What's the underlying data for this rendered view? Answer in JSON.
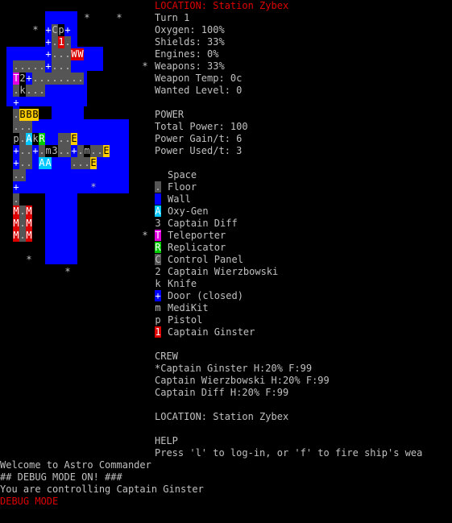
{
  "sidebar": {
    "location_title": "LOCATION: Station Zybex",
    "turn": "Turn 1",
    "oxygen": "Oxygen: 100%",
    "shields": "Shields: 33%",
    "engines": "Engines: 0%",
    "weapons": "Weapons: 33%",
    "weapon_temp": "Weapon Temp: 0c",
    "wanted_level": "Wanted Level: 0",
    "power_header": "POWER",
    "total_power": "Total Power: 100",
    "power_gain": "Power Gain/t: 6",
    "power_used": "Power Used/t: 3",
    "legend": [
      {
        "glyph": " ",
        "fg": "#000000",
        "bg": "#000000",
        "label": "Space",
        "icon": "space-icon"
      },
      {
        "glyph": ".",
        "fg": "#c0c0c0",
        "bg": "#555555",
        "label": "Floor",
        "icon": "floor-icon"
      },
      {
        "glyph": " ",
        "fg": "#0000ff",
        "bg": "#0000ff",
        "label": "Wall",
        "icon": "wall-icon"
      },
      {
        "glyph": "A",
        "fg": "#ffffff",
        "bg": "#00c8ff",
        "label": "Oxy-Gen",
        "icon": "oxy-gen-icon"
      },
      {
        "glyph": "3",
        "fg": "#c0c0c0",
        "bg": "#000000",
        "label": "Captain Diff",
        "icon": "captain-diff-icon"
      },
      {
        "glyph": "T",
        "fg": "#ffffff",
        "bg": "#e000e0",
        "label": "Teleporter",
        "icon": "teleporter-icon"
      },
      {
        "glyph": "R",
        "fg": "#ffffff",
        "bg": "#00cc00",
        "label": "Replicator",
        "icon": "replicator-icon"
      },
      {
        "glyph": "C",
        "fg": "#c0c0c0",
        "bg": "#555555",
        "label": "Control Panel",
        "icon": "control-panel-icon"
      },
      {
        "glyph": "2",
        "fg": "#c0c0c0",
        "bg": "#000000",
        "label": "Captain Wierzbowski",
        "icon": "captain-wierzbowski-icon"
      },
      {
        "glyph": "k",
        "fg": "#c0c0c0",
        "bg": "#000000",
        "label": "Knife",
        "icon": "knife-icon"
      },
      {
        "glyph": "+",
        "fg": "#ffffff",
        "bg": "#0000ff",
        "label": "Door (closed)",
        "icon": "door-closed-icon"
      },
      {
        "glyph": "m",
        "fg": "#c0c0c0",
        "bg": "#000000",
        "label": "MediKit",
        "icon": "medikit-icon"
      },
      {
        "glyph": "p",
        "fg": "#c0c0c0",
        "bg": "#000000",
        "label": "Pistol",
        "icon": "pistol-icon"
      },
      {
        "glyph": "1",
        "fg": "#ffffff",
        "bg": "#dd0000",
        "label": "Captain Ginster",
        "icon": "captain-ginster-icon"
      }
    ],
    "crew_header": "CREW",
    "crew": [
      "*Captain Ginster H:20% F:99",
      "Captain Wierzbowski H:20% F:99",
      "Captain Diff H:20% F:99"
    ],
    "location_footer": "LOCATION: Station Zybex",
    "help_header": "HELP",
    "help_text": "Press 'l' to log-in, or 'f' to fire ship's wea"
  },
  "log": [
    {
      "text": "Welcome to Astro Commander",
      "color": "#c0c0c0"
    },
    {
      "text": "## DEBUG MODE ON! ###",
      "color": "#c0c0c0"
    },
    {
      "text": "You are controlling Captain Ginster",
      "color": "#c0c0c0"
    },
    {
      "text": "DEBUG MODE",
      "color": "#dd0000"
    }
  ],
  "map": {
    "colors": {
      "wall": "#0000ff",
      "floor": "#555555",
      "oxygen": "#00c8ff",
      "teleporter": "#e000e0",
      "replicator": "#00cc00",
      "captain": "#dd0000",
      "engine": "#ffcc00",
      "gray_block": "#c8c8c8"
    },
    "stars": [
      [
        13,
        1
      ],
      [
        18,
        1
      ],
      [
        5,
        2
      ],
      [
        22,
        5
      ],
      [
        14,
        15
      ],
      [
        2,
        17
      ],
      [
        22,
        19
      ],
      [
        4,
        21
      ],
      [
        10,
        22
      ]
    ],
    "rows": [
      [
        7,
        "+Cp+"
      ],
      [
        7,
        "+.1."
      ],
      [
        7,
        "+...WW"
      ],
      [
        2,
        ".....+..."
      ],
      [
        2,
        "T2+........"
      ],
      [
        2,
        ".k..."
      ],
      [
        2,
        "+"
      ],
      [
        2,
        ".BBB"
      ],
      [
        2,
        "..."
      ],
      [
        2,
        "p.AkR  ..E"
      ],
      [
        2,
        "+..+.m3..+.m..E"
      ],
      [
        2,
        "+.. AA   ...E"
      ],
      [
        2,
        ".."
      ],
      [
        2,
        "+"
      ],
      [
        2,
        "."
      ],
      [
        2,
        "M.M"
      ],
      [
        2,
        "M.M"
      ],
      [
        2,
        "M.M"
      ]
    ]
  }
}
